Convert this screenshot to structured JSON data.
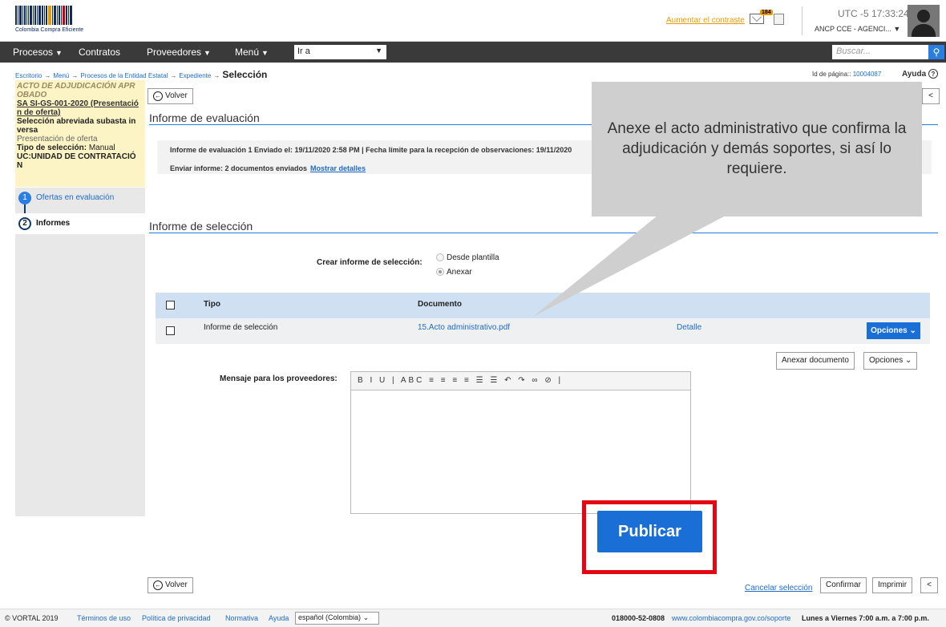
{
  "header": {
    "logo_text": "Colombia Compra Eficiente",
    "contrast_link": "Aumentar el contraste",
    "mail_count": "184",
    "timezone": "UTC -5 17:33:24",
    "account": "ANCP CCE - AGENCI... ▼"
  },
  "nav": {
    "procesos": "Procesos",
    "contratos": "Contratos",
    "proveedores": "Proveedores",
    "menu": "Menú",
    "goto_value": "Ir a",
    "search_placeholder": "Buscar..."
  },
  "breadcrumb": {
    "items": [
      "Escritorio",
      "Menú",
      "Procesos de la Entidad Estatal",
      "Expediente"
    ],
    "current": "Selección",
    "page_id_label": "Id de página::",
    "page_id": "10004087",
    "help": "Ayuda"
  },
  "left": {
    "status_line1": "ACTO DE ADJUDICACIÓN APR",
    "status_line2": "OBADO",
    "ref_line1": "SA SI-GS-001-2020 (Presentació",
    "ref_line2": "n de oferta)",
    "modality_line1": "Selección abreviada subasta in",
    "modality_line2": "versa",
    "phase": "Presentación de oferta",
    "selection_type_label": "Tipo de selección:",
    "selection_type": "Manual",
    "uc_line1": "UC:UNIDAD DE CONTRATACIÓ",
    "uc_line2": "N",
    "steps": [
      {
        "num": "1",
        "label": "Ofertas en evaluación"
      },
      {
        "num": "2",
        "label": "Informes"
      }
    ]
  },
  "buttons": {
    "volver": "Volver",
    "collapse": "<",
    "anexar_documento": "Anexar documento",
    "opciones": "Opciones",
    "publicar": "Publicar",
    "cancelar": "Cancelar selección",
    "confirmar": "Confirmar",
    "imprimir": "Imprimir"
  },
  "evaluation": {
    "title": "Informe de evaluación",
    "line1": "Informe de evaluación 1  Enviado el: 19/11/2020 2:58 PM | Fecha límite para la recepción de observaciones: 19/11/2020",
    "line2": "Enviar informe:  2 documentos enviados",
    "details_link": "Mostrar detalles"
  },
  "selection": {
    "title": "Informe de selección",
    "create_label": "Crear informe de selección:",
    "option_template": "Desde plantilla",
    "option_attach": "Anexar",
    "table": {
      "col_tipo": "Tipo",
      "col_documento": "Documento",
      "rows": [
        {
          "tipo": "Informe de selección",
          "documento": "15.Acto administrativo.pdf",
          "detalle": "Detalle",
          "opciones": "Opciones"
        }
      ]
    },
    "message_label": "Mensaje para los proveedores:",
    "toolbar_glyphs": "B I U | ABC ≡ ≡ ≡ ≡ ☰ ☰ ↶ ↷ ∞ ⊘ |"
  },
  "callout": {
    "text": "Anexe el acto administrativo que confirma la adjudicación y demás soportes, si así lo requiere."
  },
  "footer": {
    "copyright": "© VORTAL 2019",
    "terms": "Términos de uso",
    "privacy": "Política de privacidad",
    "rules": "Normativa",
    "help": "Ayuda",
    "language": "español (Colombia)",
    "phone": "018000-52-0808",
    "support_url": "www.colombiacompra.gov.co/soporte",
    "hours": "Lunes a Viernes 7:00 a.m. a 7:00 p.m."
  },
  "colors": {
    "primary_blue": "#1a6fd6",
    "highlight_red": "#e30613",
    "nav_dark": "#3a3a3a",
    "info_yellow": "#fcf4c5"
  }
}
